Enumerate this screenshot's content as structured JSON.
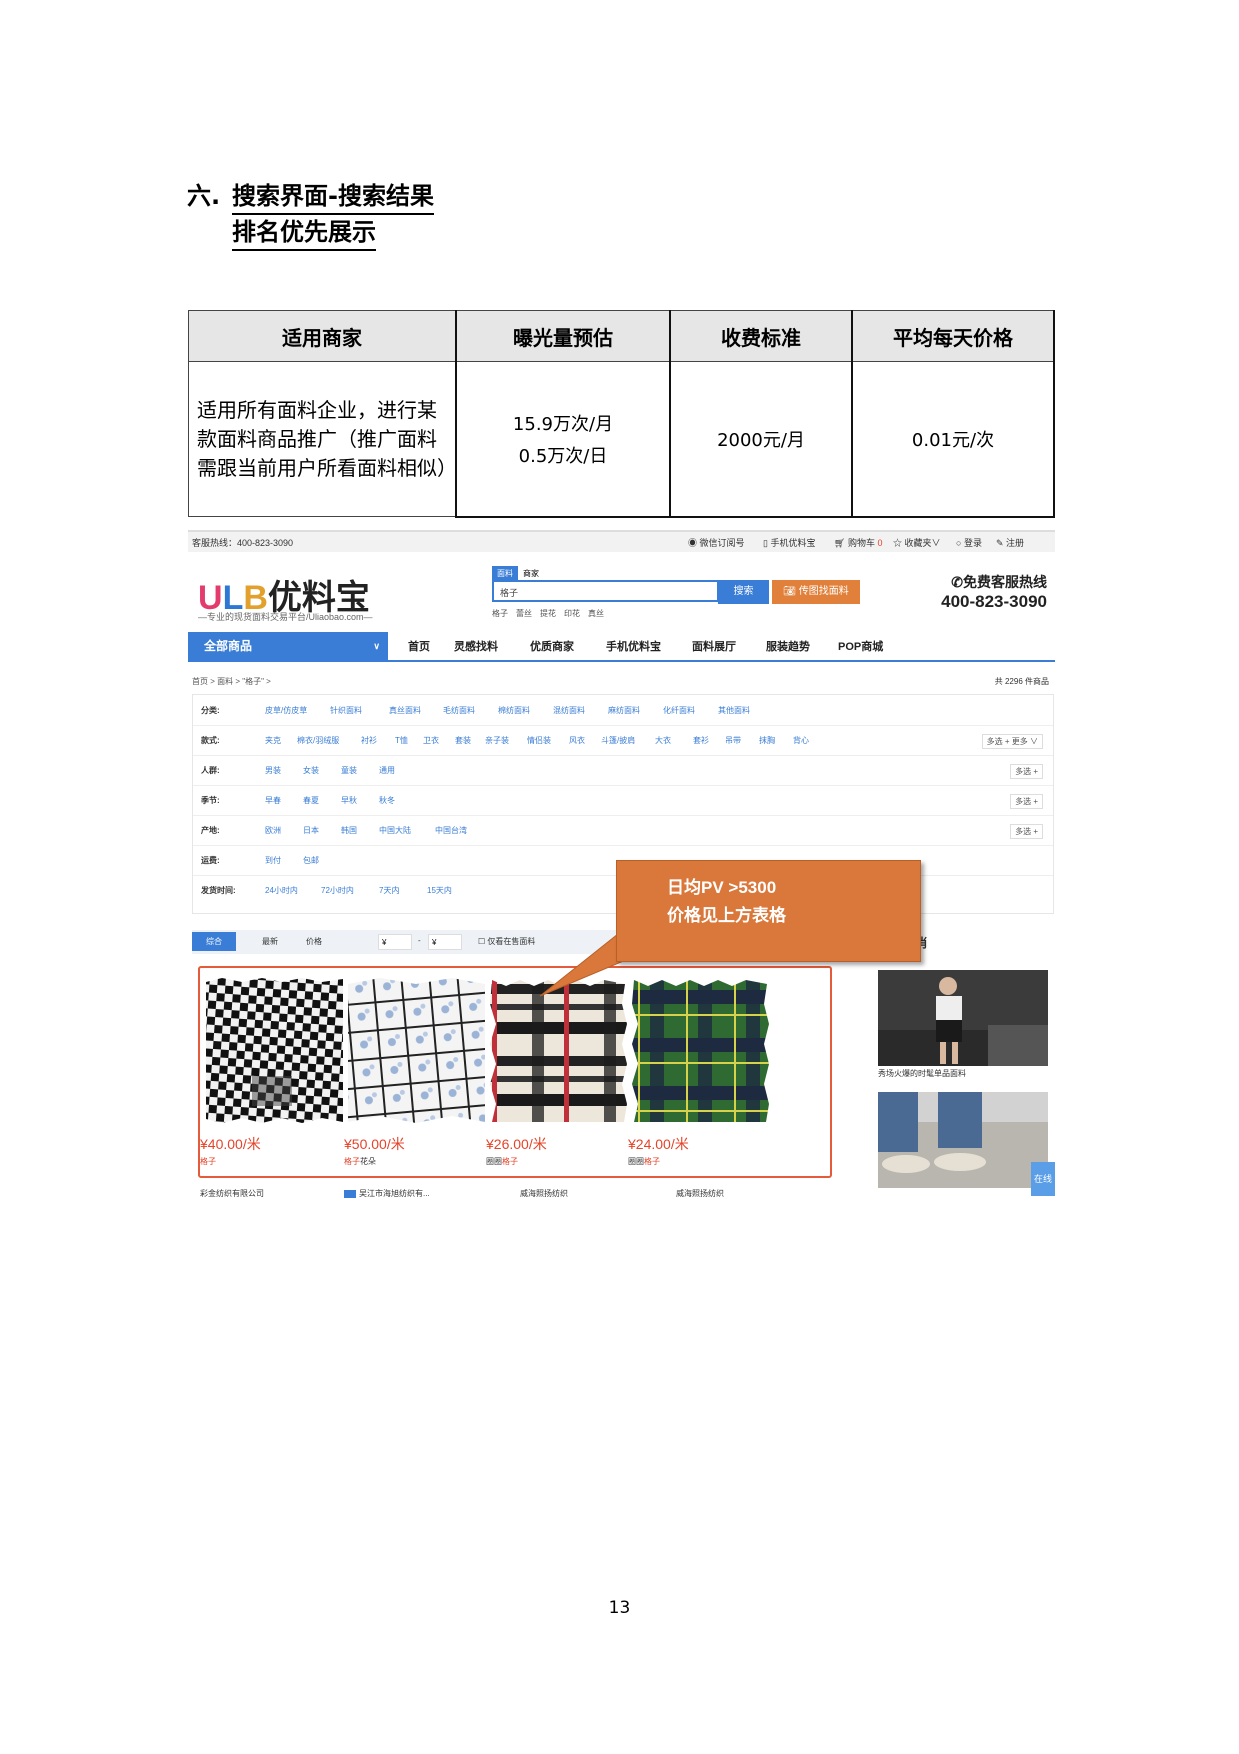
{
  "heading": {
    "number": "六.",
    "line1": "搜索界面-搜索结果",
    "line2": "排名优先展示"
  },
  "table": {
    "headers": [
      "适用商家",
      "曝光量预估",
      "收费标准",
      "平均每天价格"
    ],
    "row": {
      "merchant": "适用所有面料企业，进行某款面料商品推广（推广面料需跟当前用户所看面料相似）",
      "exposure_month": "15.9万次/月",
      "exposure_day": "0.5万次/日",
      "fee": "2000元/月",
      "daily_price": "0.01元/次"
    }
  },
  "site": {
    "topbar": {
      "hotline": "客服热线：400-823-3090",
      "wechat": "微信订阅号",
      "mobile": "手机优料宝",
      "cart": "购物车",
      "cart_count": "0",
      "favorites": "收藏夹",
      "login": "登录",
      "register": "注册"
    },
    "logo": {
      "letters": [
        "U",
        "L",
        "B"
      ],
      "name": "优料宝",
      "slogan": "—专业的现货面料交易平台/Uliaobao.com—"
    },
    "search": {
      "tabs": [
        "面料",
        "商家"
      ],
      "value": "格子",
      "button": "搜索",
      "image_button": "传图找面料",
      "hot": [
        "格子",
        "蕾丝",
        "提花",
        "印花",
        "真丝"
      ]
    },
    "service": {
      "title": "✆免费客服热线",
      "number": "400-823-3090"
    },
    "nav": {
      "all": "全部商品",
      "items": [
        "首页",
        "灵感找料",
        "优质商家",
        "手机优料宝",
        "面料展厅",
        "服装趋势",
        "POP商城"
      ]
    },
    "breadcrumb": "首页 > 面料 > \"格子\" >",
    "count": "共 2296 件商品",
    "filters": [
      {
        "label": "分类:",
        "options": [
          "皮草/仿皮草",
          "针织面料",
          "真丝面料",
          "毛纺面料",
          "棉纺面料",
          "混纺面料",
          "麻纺面料",
          "化纤面料",
          "其他面料"
        ],
        "more": ""
      },
      {
        "label": "款式:",
        "options": [
          "夹克",
          "棉衣/羽绒服",
          "衬衫",
          "T恤",
          "卫衣",
          "套装",
          "亲子装",
          "情侣装",
          "风衣",
          "斗篷/披肩",
          "大衣",
          "套衫",
          "吊带",
          "抹胸",
          "背心"
        ],
        "more": "多选 +   更多 ∨"
      },
      {
        "label": "人群:",
        "options": [
          "男装",
          "女装",
          "童装",
          "通用"
        ],
        "more": "多选 +"
      },
      {
        "label": "季节:",
        "options": [
          "早春",
          "春夏",
          "早秋",
          "秋冬"
        ],
        "more": "多选 +"
      },
      {
        "label": "产地:",
        "options": [
          "欧洲",
          "日本",
          "韩国",
          "中国大陆",
          "中国台湾"
        ],
        "more": "多选 +"
      },
      {
        "label": "运费:",
        "options": [
          "到付",
          "包邮"
        ],
        "more": ""
      },
      {
        "label": "发货时间:",
        "options": [
          "24小时内",
          "72小时内",
          "7天内",
          "15天内"
        ],
        "more": ""
      }
    ],
    "sort": {
      "items": [
        "综合",
        "最新",
        "价格"
      ],
      "price_from": "¥",
      "price_sep": "-",
      "price_to": "¥",
      "only_sale": "仅看在售面料"
    },
    "callout": {
      "line1": "日均PV >5300",
      "line2": "价格见上方表格"
    },
    "products": [
      {
        "price": "¥40.00/米",
        "tag_hl": "格子",
        "tag_rest": "",
        "seller": "彩金纺织有限公司"
      },
      {
        "price": "¥50.00/米",
        "tag_hl": "格子",
        "tag_rest": "花朵",
        "seller": "吴江市海旭纺织有..."
      },
      {
        "price": "¥26.00/米",
        "tag_hl": "格子",
        "tag_rest": "圈圈",
        "seller": "威海照扬纺织"
      },
      {
        "price": "¥24.00/米",
        "tag_hl": "格子",
        "tag_rest": "圈圈",
        "seller": "威海照扬纺织"
      }
    ],
    "side": {
      "heading_fragment": "肖",
      "caption": "秀场火爆的时髦单品面料",
      "online": "在线"
    }
  },
  "page_number": "13"
}
